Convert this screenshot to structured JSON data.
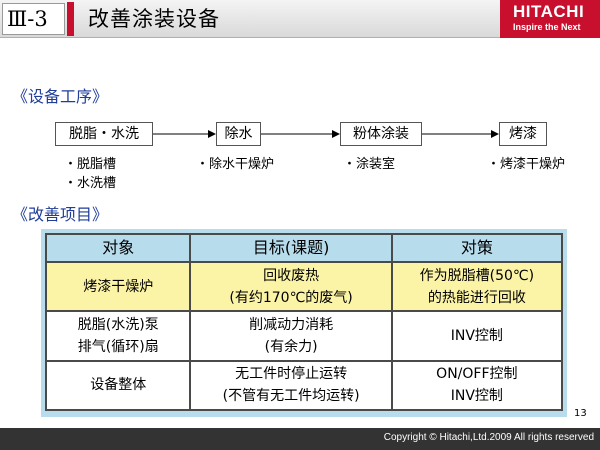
{
  "header": {
    "section_no": "Ⅲ-3",
    "title": "改善涂装设备",
    "brand": {
      "name": "HITACHI",
      "tagline": "Inspire the Next"
    }
  },
  "process": {
    "heading": "《设备工序》",
    "steps": [
      {
        "name": "脱脂・水洗",
        "items": [
          "・脱脂槽",
          "・水洗槽"
        ]
      },
      {
        "name": "除水",
        "items": [
          "・除水干燥炉"
        ]
      },
      {
        "name": "粉体涂装",
        "items": [
          "・涂装室"
        ]
      },
      {
        "name": "烤漆",
        "items": [
          "・烤漆干燥炉"
        ]
      }
    ]
  },
  "improvements": {
    "heading": "《改善项目》",
    "columns": [
      "对象",
      "目标(课题)",
      "对策"
    ],
    "rows": [
      {
        "target": [
          "烤漆干燥炉"
        ],
        "goal": [
          "回收废热",
          "(有约170℃的废气)"
        ],
        "measure": [
          "作为脱脂槽(50℃)",
          "的热能进行回收"
        ],
        "highlight": true
      },
      {
        "target": [
          "脱脂(水洗)泵",
          "排气(循环)扇"
        ],
        "goal": [
          "削减动力消耗",
          "(有余力)"
        ],
        "measure": [
          "INV控制"
        ],
        "highlight": false
      },
      {
        "target": [
          "设备整体"
        ],
        "goal": [
          "无工件时停止运转",
          "(不管有无工件均运转)"
        ],
        "measure": [
          "ON/OFF控制",
          "INV控制"
        ],
        "highlight": false
      }
    ]
  },
  "page_number": "13",
  "footer": {
    "copyright": "Copyright © Hitachi,Ltd.2009 All rights reserved"
  },
  "colors": {
    "brand_red": "#c8102e",
    "heading_blue": "#1f3d99",
    "table_frame": "#b7dcec",
    "highlight_row": "#fbf3a5",
    "footer_bg": "#333333"
  }
}
